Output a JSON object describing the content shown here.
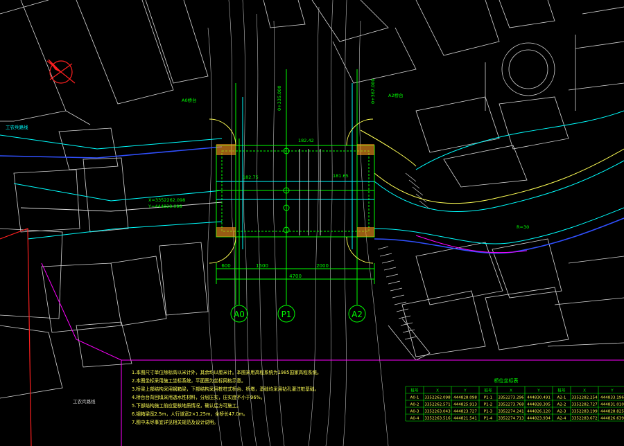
{
  "drawing": {
    "axis_labels": [
      "A0",
      "P1",
      "A2"
    ],
    "dimensions": {
      "span_left": "600",
      "span_mid": "1500",
      "span_right": "2000",
      "total": "4700"
    },
    "road_labels": {
      "left_road": "工农兵路线",
      "bottom_left_road": "工农兵路线",
      "curve_radius": "R=30"
    },
    "bridge_labels": {
      "axis_top_left": "0+335.000",
      "axis_top_right": "0+367.000",
      "pier_a0_note": "A0桥台",
      "pier_a2_note": "A2桥台",
      "coord_1": "X=3352262.098",
      "coord_2": "Y=444828.098",
      "elev_1": "182.75",
      "elev_2": "182.42",
      "elev_3": "181.65"
    },
    "colors": {
      "background": "#000000",
      "cad_green": "#00ff00",
      "cad_cyan": "#00ffff",
      "cad_white": "#e8e8e8",
      "cad_magenta": "#ff00ff",
      "cad_yellow": "#ffff55",
      "cad_red": "#ff2020",
      "cad_blue": "#3050ff",
      "cad_orange": "#ff9a20"
    }
  },
  "notes": {
    "lines": [
      "1.本图尺寸单位除标高以米计外，其余均以厘米计。本图采用高程系统为1985国家高程系统。",
      "2.本图坐标采用施工坐标系统，平面图为坐标网格示意。",
      "3.桥梁上部结构采用钢箱梁，下部结构采用桩柱式桥台、桥墩，基础均采用钻孔灌注桩基础。",
      "4.桥台台背回填采用透水性材料，分层压实，压实度不小于96%。",
      "5.下部结构施工前应复核地质情况，确认后方可施工。",
      "6.钢箱梁宽2.5m，人行道宽2×1.25m，全桥长47.0m。",
      "7.图中未尽事宜详见相关规范及设计说明。"
    ]
  },
  "coord_table": {
    "title": "桥位坐标表",
    "headers": [
      "桩号",
      "X",
      "Y",
      "桩号",
      "X",
      "Y",
      "桩号",
      "X",
      "Y"
    ],
    "rows": [
      [
        "A0-1",
        "3352262.098",
        "444828.098",
        "P1-1",
        "3352273.296",
        "444830.491",
        "A2-1",
        "3352282.254",
        "444833.196"
      ],
      [
        "A0-2",
        "3352262.571",
        "444825.913",
        "P1-2",
        "3352273.768",
        "444828.305",
        "A2-2",
        "3352282.727",
        "444831.010"
      ],
      [
        "A0-3",
        "3352263.043",
        "444823.727",
        "P1-3",
        "3352274.241",
        "444826.120",
        "A2-3",
        "3352283.199",
        "444828.825"
      ],
      [
        "A0-4",
        "3352263.516",
        "444821.541",
        "P1-4",
        "3352274.713",
        "444823.934",
        "A2-4",
        "3352283.672",
        "444826.639"
      ]
    ]
  }
}
